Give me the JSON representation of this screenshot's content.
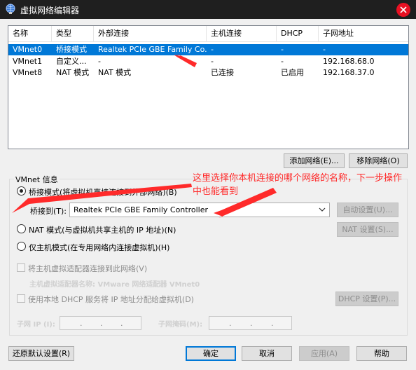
{
  "window": {
    "title": "虚拟网络编辑器"
  },
  "list": {
    "headers": [
      "名称",
      "类型",
      "外部连接",
      "主机连接",
      "DHCP",
      "子网地址"
    ],
    "rows": [
      {
        "name": "VMnet0",
        "type": "桥接模式",
        "external": "Realtek PCIe GBE Family Co...",
        "host": "-",
        "dhcp": "-",
        "subnet": "-",
        "selected": true
      },
      {
        "name": "VMnet1",
        "type": "自定义...",
        "external": "-",
        "host": "-",
        "dhcp": "-",
        "subnet": "192.168.68.0",
        "selected": false
      },
      {
        "name": "VMnet8",
        "type": "NAT 模式",
        "external": "NAT 模式",
        "host": "已连接",
        "dhcp": "已启用",
        "subnet": "192.168.37.0",
        "selected": false
      }
    ]
  },
  "buttons": {
    "add_network": "添加网络(E)...",
    "remove_network": "移除网络(O)",
    "auto_settings": "自动设置(U)...",
    "nat_settings": "NAT 设置(S)...",
    "dhcp_settings": "DHCP 设置(P)...",
    "restore_defaults": "还原默认设置(R)",
    "ok": "确定",
    "cancel": "取消",
    "apply": "应用(A)",
    "help": "帮助"
  },
  "vmnet_info": {
    "legend": "VMnet 信息",
    "bridged_label": "桥接模式(将虚拟机直接连接到外部网络)(B)",
    "bridged_to_label": "桥接到(T):",
    "bridged_to_value": "Realtek PCIe GBE Family Controller",
    "nat_label": "NAT 模式(与虚拟机共享主机的 IP 地址)(N)",
    "host_only_label": "仅主机模式(在专用网络内连接虚拟机)(H)",
    "connect_adapter_label": "将主机虚拟适配器连接到此网络(V)",
    "adapter_name_label": "主机虚拟适配器名称: VMware 网络适配器 VMnet0",
    "use_dhcp_label": "使用本地 DHCP 服务将 IP 地址分配给虚拟机(D)",
    "subnet_ip_label": "子网 IP (I):",
    "subnet_mask_label": "子网掩码(M):",
    "selected_mode": "bridged"
  },
  "annotation": {
    "text": "这里选择你本机连接的哪个网络的名称，下一步操作中也能看到",
    "color": "#ff2a2a"
  },
  "colors": {
    "selection": "#0078d7",
    "titlebar": "#1f1f1f",
    "close": "#e81123"
  }
}
